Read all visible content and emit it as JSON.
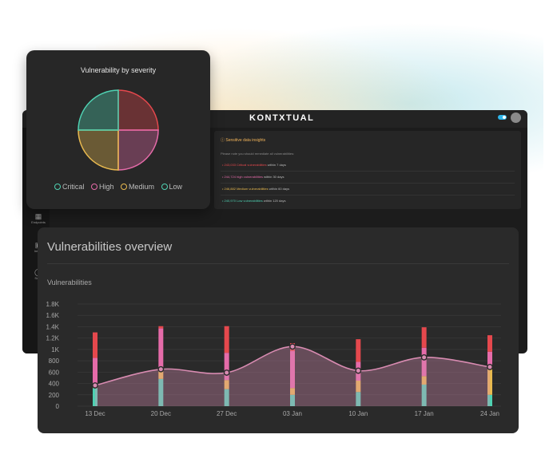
{
  "app": {
    "brand": "KONTXTUAL",
    "sidebar": [
      {
        "label": "Endpoints",
        "icon": "grid-icon"
      },
      {
        "label": "Insigh",
        "icon": "monitor-icon"
      },
      {
        "label": "Supp",
        "icon": "headset-icon"
      }
    ]
  },
  "insights": {
    "title": "Sensitive data insights",
    "intro": "Please note you should remediate all vulnerabilities:",
    "items": [
      {
        "highlight": "243,033 Critical vulnerabilities",
        "rest": " within 7 days",
        "color": "#e5484d"
      },
      {
        "highlight": "244,724 high vulnerabilities",
        "rest": " within 30 days",
        "color": "#e56ba9"
      },
      {
        "highlight": "246,882 Medium vulnerabilities",
        "rest": " within 60 days",
        "color": "#e8b94f"
      },
      {
        "highlight": "240,970 Low vulnerabilities",
        "rest": " within 120 days",
        "color": "#4fd1b2"
      }
    ]
  },
  "overview": {
    "title": "Vulnerabilities overview",
    "subtitle": "Vulnerabilities"
  },
  "pie": {
    "title": "Vulnerability by severity",
    "legend": [
      "Critical",
      "High",
      "Medium",
      "Low"
    ]
  },
  "colors": {
    "critical": "#e5484d",
    "high": "#e56ba9",
    "medium": "#e8b94f",
    "low": "#4fd1b2",
    "area": "#d88bb1"
  },
  "chart_data": [
    {
      "type": "pie",
      "title": "Vulnerability by severity",
      "categories": [
        "Critical",
        "High",
        "Medium",
        "Low"
      ],
      "values": [
        25,
        25,
        25,
        25
      ],
      "colors": [
        "#e5484d",
        "#e56ba9",
        "#e8b94f",
        "#4fd1b2"
      ],
      "legend": "bottom"
    },
    {
      "type": "bar",
      "stacked": true,
      "categories": [
        "13 Dec",
        "20 Dec",
        "27 Dec",
        "03 Jan",
        "10 Jan",
        "17 Jan",
        "24 Jan"
      ],
      "yticks": [
        "0",
        "200",
        "400",
        "600",
        "800",
        "1K",
        "1.2K",
        "1.4K",
        "1.6K",
        "1.8K"
      ],
      "ylim": [
        0,
        1800
      ],
      "grid": true,
      "series": [
        {
          "name": "Low",
          "values": [
            320,
            480,
            300,
            200,
            250,
            380,
            200
          ]
        },
        {
          "name": "Medium",
          "values": [
            30,
            140,
            160,
            120,
            200,
            150,
            460
          ]
        },
        {
          "name": "High",
          "values": [
            500,
            750,
            480,
            650,
            330,
            500,
            300
          ]
        },
        {
          "name": "Critical",
          "values": [
            450,
            40,
            470,
            140,
            400,
            360,
            290
          ]
        }
      ],
      "line": {
        "values": [
          365,
          650,
          590,
          1050,
          625,
          860,
          690
        ]
      }
    }
  ]
}
